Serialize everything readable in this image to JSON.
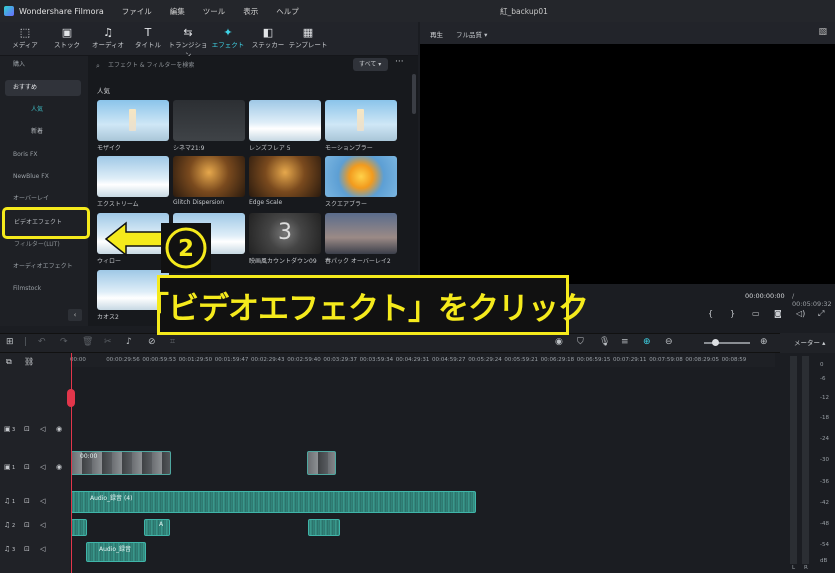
{
  "app": {
    "name": "Wondershare Filmora",
    "doc_name": "紅_backup01"
  },
  "menu": [
    "ファイル",
    "編集",
    "ツール",
    "表示",
    "ヘルプ"
  ],
  "toolbar": [
    {
      "label": "メディア",
      "icon": "media-icon"
    },
    {
      "label": "ストック",
      "icon": "stock-icon"
    },
    {
      "label": "オーディオ",
      "icon": "audio-icon"
    },
    {
      "label": "タイトル",
      "icon": "title-icon"
    },
    {
      "label": "トランジション",
      "icon": "transition-icon"
    },
    {
      "label": "エフェクト",
      "icon": "effect-icon",
      "active": true
    },
    {
      "label": "ステッカー",
      "icon": "sticker-icon"
    },
    {
      "label": "テンプレート",
      "icon": "template-icon"
    }
  ],
  "sidebar": {
    "items": [
      {
        "label": "購入"
      },
      {
        "label": "おすすめ",
        "active": true
      },
      {
        "label": "人気"
      },
      {
        "label": "新着"
      },
      {
        "label": "Boris FX"
      },
      {
        "label": "NewBlue FX"
      },
      {
        "label": "オーバーレイ"
      },
      {
        "label": "ビデオエフェクト"
      },
      {
        "label": "フィルター(LUT)"
      },
      {
        "label": "オーディオエフェクト"
      },
      {
        "label": "Filmstock"
      }
    ]
  },
  "browser": {
    "search_placeholder": "エフェクト & フィルターを検索",
    "filter_label": "すべて",
    "section_title": "人気",
    "cards": [
      {
        "label": "モザイク"
      },
      {
        "label": "シネマ21:9"
      },
      {
        "label": "レンズフレア 5"
      },
      {
        "label": "モーションブラー"
      },
      {
        "label": "エクストリーム"
      },
      {
        "label": "Glitch Dispersion"
      },
      {
        "label": "Edge Scale"
      },
      {
        "label": "スクエアブラー"
      },
      {
        "label": "ウィロー"
      },
      {
        "label": ""
      },
      {
        "label": "映画風カウントダウン09"
      },
      {
        "label": "春パック オーバーレイ2"
      },
      {
        "label": "カオス2"
      }
    ],
    "countdown_digit": "3"
  },
  "preview": {
    "tab": "再生",
    "quality": "フル品質",
    "current_time": "00:00:00:00",
    "total_time": "/ 00:05:09:32"
  },
  "timeline": {
    "meter_label": "メーター",
    "ruler": [
      "00:00",
      "00:00:29:56",
      "00:00:59:53",
      "00:01:29:50",
      "00:01:59:47",
      "00:02:29:43",
      "00:02:59:40",
      "00:03:29:37",
      "00:03:59:34",
      "00:04:29:31",
      "00:04:59:27",
      "00:05:29:24",
      "00:05:59:21",
      "00:06:29:18",
      "00:06:59:15",
      "00:07:29:11",
      "00:07:59:08",
      "00:08:29:05",
      "00:08:59"
    ],
    "meter_scale": [
      "0",
      "-6",
      "-12",
      "-18",
      "-24",
      "-30",
      "-36",
      "-42",
      "-48",
      "-54",
      "dB"
    ],
    "meter_channels": [
      "L",
      "R"
    ],
    "track_nums": [
      "3",
      "1",
      "1",
      "2",
      "3"
    ],
    "clips": {
      "video_a": "00:00",
      "audio_main": "Audio_録音 (4)",
      "audio_small": "A",
      "audio_bottom": "Audio_録音"
    }
  },
  "annotation": {
    "badge": "②",
    "callout": "「ビデオエフェクト」をクリック",
    "color": "#f5ea1c"
  }
}
